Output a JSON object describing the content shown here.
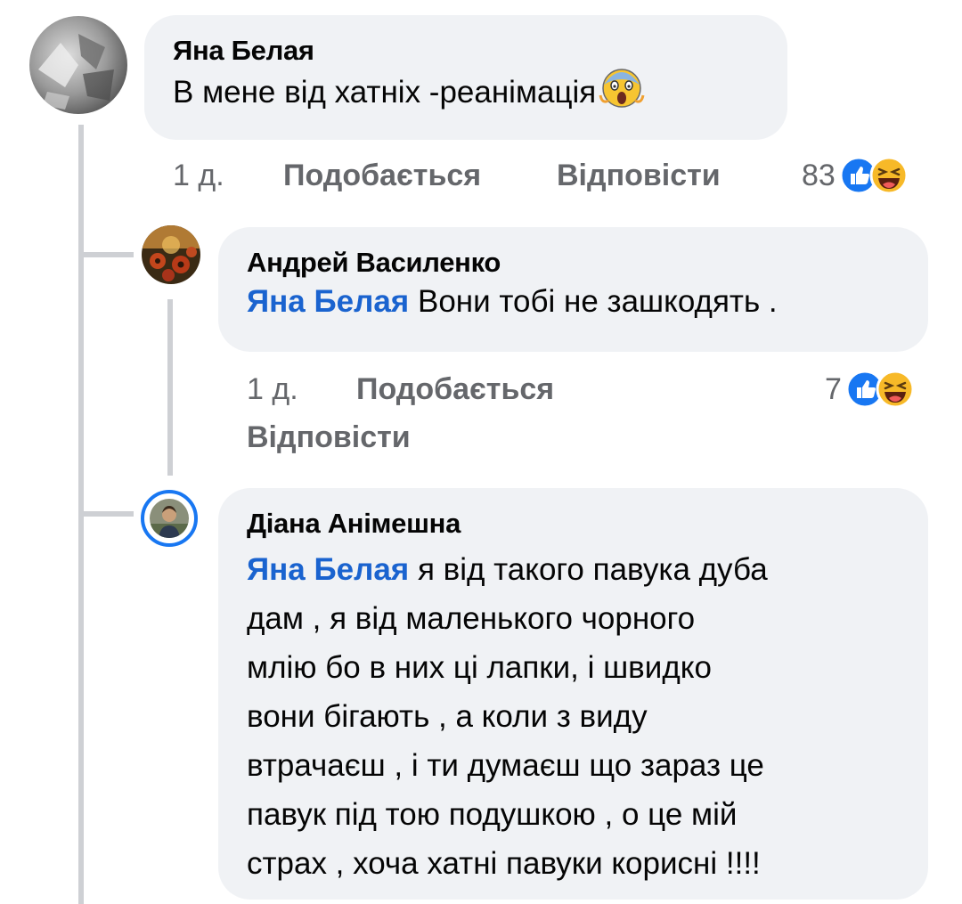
{
  "comments": [
    {
      "author": "Яна Белая",
      "text": "В мене від хатніх -реанімація",
      "time": "1 д.",
      "like_label": "Подобається",
      "reply_label": "Відповісти",
      "reaction_count": "83",
      "reaction_icons": [
        "like-icon",
        "laugh-icon"
      ],
      "trailing_emoji": "scream-emoji-icon"
    },
    {
      "author": "Андрей Василенко",
      "mention": "Яна Белая",
      "text": "Вони тобі не зашкодять .",
      "time": "1 д.",
      "like_label": "Подобається",
      "reply_label": "Відповісти",
      "reaction_count": "7",
      "reaction_icons": [
        "like-icon",
        "laugh-icon"
      ]
    },
    {
      "author": "Діана Анімешна",
      "mention": "Яна Белая",
      "text_lines": [
        "я від такого павука дуба",
        "дам , я від маленького чорного",
        "млію бо в них ці лапки, і швидко",
        "вони бігають , а коли з виду",
        "втрачаєш , і ти думаєш що зараз це",
        "павук під тою подушкою , о це мій",
        "страх , хоча хатні павуки корисні !!!!"
      ]
    }
  ],
  "colors": {
    "bubble": "#f0f2f5",
    "mention": "#1a63cf",
    "meta": "#65676b",
    "like_blue": "#1877f2",
    "laugh_yellow": "#f7b928"
  }
}
